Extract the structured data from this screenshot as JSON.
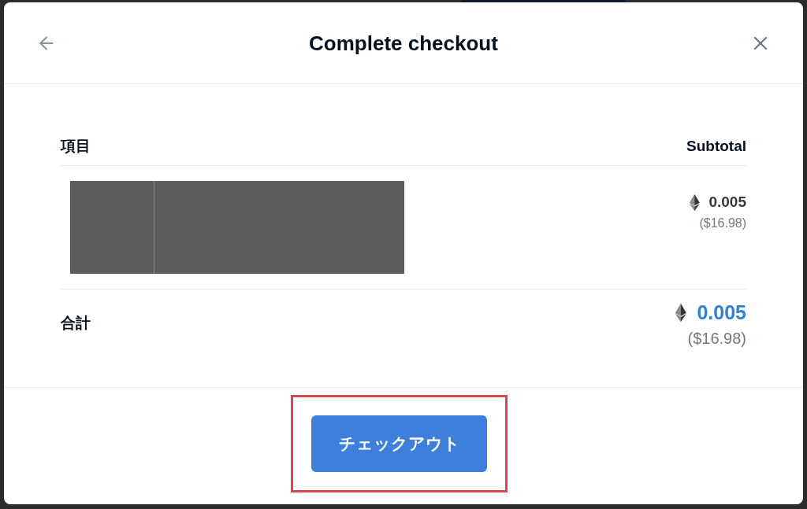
{
  "dialog": {
    "title": "Complete checkout"
  },
  "table": {
    "columns": [
      "項目",
      "Subtotal"
    ],
    "rows": [
      {
        "price": "0.005",
        "usd": "($16.98)"
      }
    ]
  },
  "total": {
    "label": "合計",
    "price": "0.005",
    "usd": "($16.98)"
  },
  "checkout_button": {
    "label": "チェックアウト",
    "highlighted": true
  }
}
